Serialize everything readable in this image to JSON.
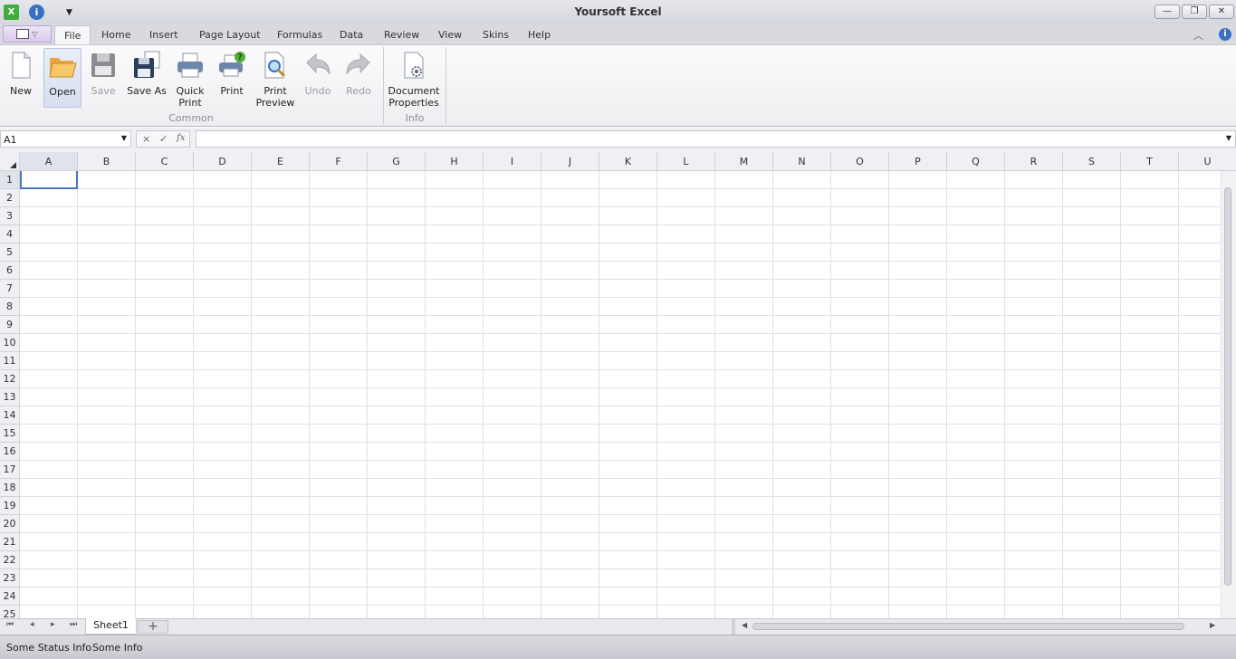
{
  "window": {
    "title": "Yoursoft Excel",
    "minimize": "—",
    "restore": "❐",
    "close": "✕"
  },
  "tabs": [
    "File",
    "Home",
    "Insert",
    "Page Layout",
    "Formulas",
    "Data",
    "Review",
    "View",
    "Skins",
    "Help"
  ],
  "active_tab": "File",
  "ribbon": {
    "buttons": [
      {
        "label": "New",
        "state": "normal"
      },
      {
        "label": "Open",
        "state": "selected"
      },
      {
        "label": "Save",
        "state": "disabled"
      },
      {
        "label": "Save As",
        "state": "normal"
      },
      {
        "label": "Quick Print",
        "state": "normal"
      },
      {
        "label": "Print",
        "state": "normal"
      },
      {
        "label": "Print Preview",
        "state": "normal"
      },
      {
        "label": "Undo",
        "state": "disabled"
      },
      {
        "label": "Redo",
        "state": "disabled"
      },
      {
        "label": "Document Properties",
        "state": "normal"
      }
    ],
    "groups": [
      "Common",
      "Info"
    ]
  },
  "formula_bar": {
    "name_box": "A1",
    "cancel": "×",
    "enter": "✓",
    "fx": "fx",
    "formula": ""
  },
  "columns": [
    "A",
    "B",
    "C",
    "D",
    "E",
    "F",
    "G",
    "H",
    "I",
    "J",
    "K",
    "L",
    "M",
    "N",
    "O",
    "P",
    "Q",
    "R",
    "S",
    "T",
    "U"
  ],
  "rows": [
    "1",
    "2",
    "3",
    "4",
    "5",
    "6",
    "7",
    "8",
    "9",
    "10",
    "11",
    "12",
    "13",
    "14",
    "15",
    "16",
    "17",
    "18",
    "19",
    "20",
    "21",
    "22",
    "23",
    "24",
    "25"
  ],
  "selected_cell": "A1",
  "sheets": [
    "Sheet1"
  ],
  "add_sheet": "+",
  "status": {
    "left": "Some Status Info",
    "right": "Some Info"
  },
  "colors": {
    "accent": "#4a76c0",
    "grid": "#e0e1e5"
  }
}
